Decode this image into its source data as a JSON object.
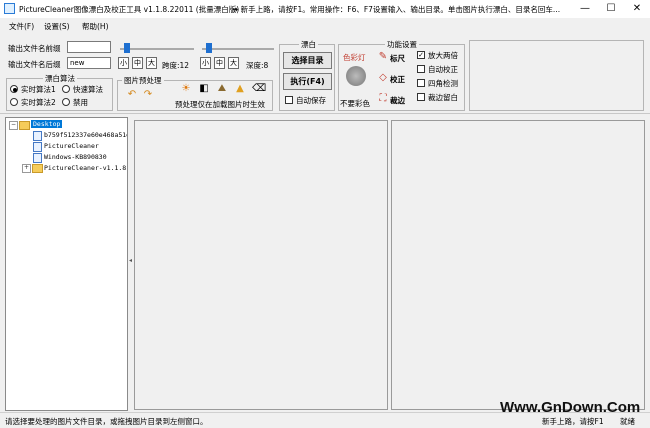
{
  "window": {
    "title": "PictureCleaner图像漂白及校正工具 v1.1.8.22011 (批量漂白版)",
    "marquee": "➜ 新手上路，请按F1。常用操作：F6、F7设置输入、输出目录。单击图片执行漂白、目录名回车...",
    "minimize": "—",
    "maximize": "☐",
    "close": "✕"
  },
  "menu": [
    {
      "label": "文件(F)"
    },
    {
      "label": "设置(S)"
    },
    {
      "label": "帮助(H)"
    }
  ],
  "output": {
    "prefix_label": "输出文件名前缀",
    "prefix_value": "",
    "suffix_label": "输出文件名后缀",
    "suffix_value": "new"
  },
  "algorithm": {
    "title": "漂白算法",
    "options": [
      "实时算法1",
      "快速算法",
      "实时算法2",
      "禁用"
    ],
    "selected": "实时算法1"
  },
  "sliders": {
    "size_buttons": [
      "小",
      "中",
      "大"
    ],
    "brightness_label": "跨度:12",
    "depth_label": "深度:8",
    "brightness_value": 12,
    "depth_value": 8
  },
  "preprocess": {
    "title": "图片预处理",
    "note": "预处理仅在加载图片时生效",
    "tools": [
      "undo-icon",
      "redo-icon",
      "brightness-icon",
      "contrast-icon",
      "landscape-icon",
      "triangle-icon",
      "eraser-icon"
    ]
  },
  "bleach": {
    "title": "漂白",
    "select_dir": "选择目录",
    "execute": "执行(F4)",
    "autosave": "自动保存"
  },
  "functions": {
    "title": "功能设置",
    "color_light": "色彩灯",
    "no_color": "不要彩色",
    "ruler": "标尺",
    "correct": "校正",
    "crop": "裁边",
    "checks": [
      {
        "label": "放大两倍",
        "checked": true
      },
      {
        "label": "自动校正",
        "checked": false
      },
      {
        "label": "四角检测",
        "checked": false
      },
      {
        "label": "裁边留白",
        "checked": false
      }
    ]
  },
  "tree": [
    {
      "label": "Desktop",
      "type": "folder",
      "level": 0,
      "selected": true,
      "expander": "−"
    },
    {
      "label": "b759f512337e60e468a51e",
      "type": "file",
      "level": 1
    },
    {
      "label": "PictureCleaner",
      "type": "file",
      "level": 1
    },
    {
      "label": "Windows-KB890830",
      "type": "file",
      "level": 1
    },
    {
      "label": "PictureCleaner-v1.1.8.",
      "type": "folder",
      "level": 1,
      "expander": "+"
    }
  ],
  "status": {
    "message": "请选择要处理的图片文件目录，或拖拽图片目录到左侧窗口。",
    "hint": "新手上路，请按F1",
    "state": "就绪"
  },
  "watermark": "Www.GnDown.Com",
  "colors": {
    "accent": "#1e6fd0",
    "tree_selected": "#0078d7",
    "red_tool": "#c0392b"
  }
}
